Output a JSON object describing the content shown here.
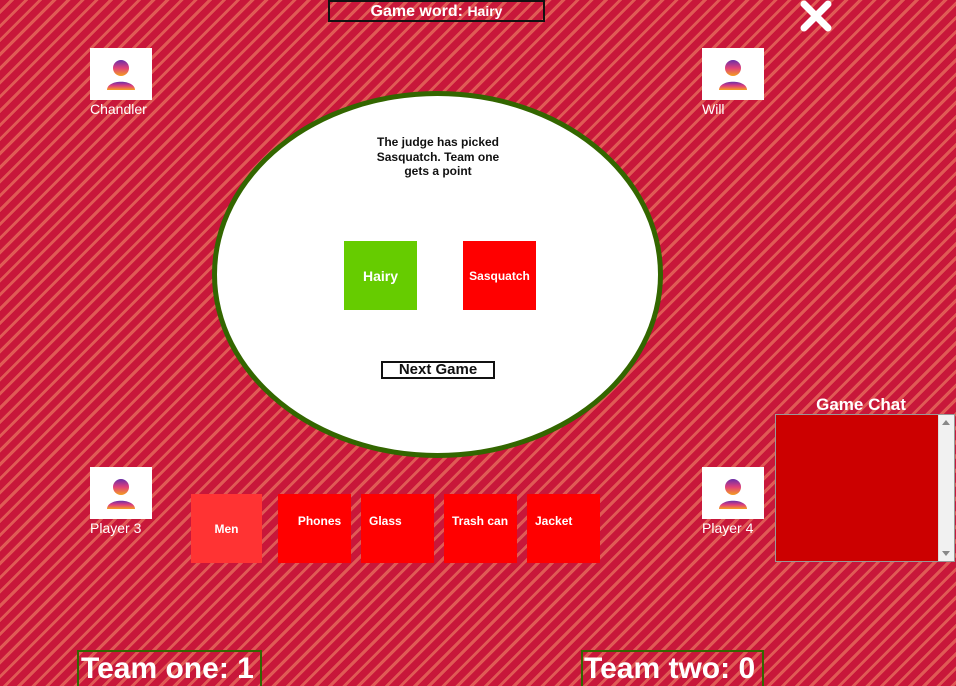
{
  "header": {
    "game_word_label": "Game word:",
    "game_word_value": "Hairy"
  },
  "players": {
    "top_left": "Chandler",
    "top_right": "Will",
    "bottom_left": "Player 3",
    "bottom_right": "Player 4"
  },
  "table": {
    "message": "The judge has picked Sasquatch. Team one gets a point",
    "played_cards": [
      {
        "label": "Hairy",
        "color": "#66cc00"
      },
      {
        "label": "Sasquatch",
        "color": "#ff0000"
      }
    ],
    "next_game_label": "Next Game"
  },
  "hand": {
    "cards": [
      {
        "label": "Men",
        "color": "#ff3333"
      },
      {
        "label": "Phones",
        "color": "#ff0000"
      },
      {
        "label": "Glass",
        "color": "#ff0000"
      },
      {
        "label": "Trash can",
        "color": "#ff0000"
      },
      {
        "label": "Jacket",
        "color": "#ff0000"
      }
    ]
  },
  "chat": {
    "title": "Game Chat"
  },
  "scores": {
    "team_one": "Team one: 1",
    "team_two": "Team two: 0"
  },
  "icons": {
    "close": "close-icon",
    "avatar": "user-avatar-icon"
  },
  "colors": {
    "background": "#c8102e",
    "table_border": "#336600",
    "chat_bg": "#cc0000"
  }
}
